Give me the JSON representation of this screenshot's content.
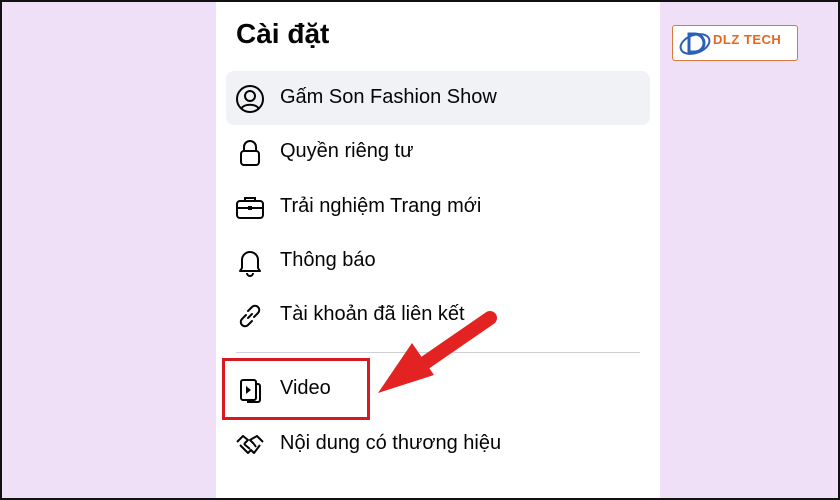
{
  "page": {
    "title": "Cài đặt"
  },
  "menu": {
    "items": [
      {
        "label": "Gấm Son Fashion Show",
        "icon": "profile-icon",
        "selected": true
      },
      {
        "label": "Quyền riêng tư",
        "icon": "lock-icon"
      },
      {
        "label": "Trải nghiệm Trang mới",
        "icon": "briefcase-icon"
      },
      {
        "label": "Thông báo",
        "icon": "bell-icon"
      },
      {
        "label": "Tài khoản đã liên kết",
        "icon": "link-icon"
      },
      {
        "label": "Video",
        "icon": "video-icon"
      },
      {
        "label": "Nội dung có thương hiệu",
        "icon": "handshake-icon"
      }
    ]
  },
  "watermark": {
    "brand": "DLZ TECH"
  },
  "colors": {
    "background": "#efdff7",
    "panel": "#ffffff",
    "selected": "#f0f2f5",
    "highlight": "#d71920",
    "arrow": "#e32222",
    "brand": "#e8651d"
  }
}
